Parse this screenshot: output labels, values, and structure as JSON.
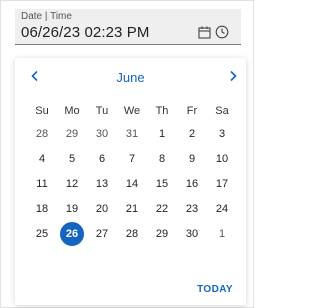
{
  "field": {
    "label": "Date | Time",
    "value": "06/26/23 02:23 PM",
    "calendar_icon": "calendar-icon",
    "clock_icon": "clock-icon"
  },
  "calendar": {
    "month": "June",
    "prev_icon": "chevron-left-icon",
    "next_icon": "chevron-right-icon",
    "weekdays": [
      "Su",
      "Mo",
      "Tu",
      "We",
      "Th",
      "Fr",
      "Sa"
    ],
    "weeks": [
      [
        "28",
        "29",
        "30",
        "31",
        "1",
        "2",
        "3"
      ],
      [
        "4",
        "5",
        "6",
        "7",
        "8",
        "9",
        "10"
      ],
      [
        "11",
        "12",
        "13",
        "14",
        "15",
        "16",
        "17"
      ],
      [
        "18",
        "19",
        "20",
        "21",
        "22",
        "23",
        "24"
      ],
      [
        "25",
        "26",
        "27",
        "28",
        "29",
        "30",
        "1"
      ]
    ],
    "selected_day": "26",
    "today_label": "TODAY"
  },
  "colors": {
    "accent": "#1565c0",
    "field_bg": "#efefef"
  }
}
